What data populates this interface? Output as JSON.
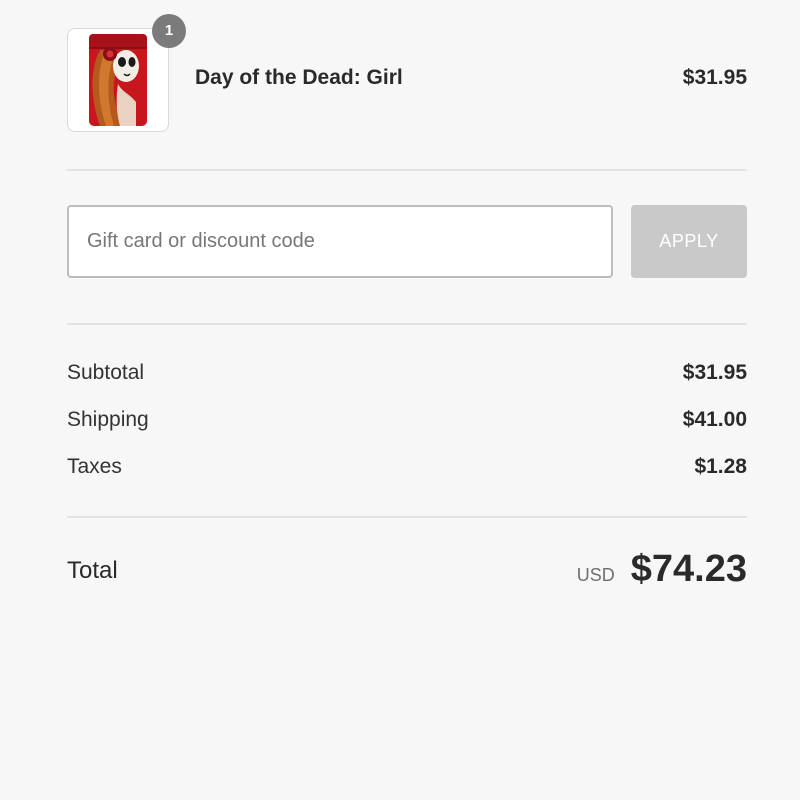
{
  "product": {
    "quantity": "1",
    "name": "Day of the Dead: Girl",
    "price": "$31.95",
    "thumbnail_icon": "day-of-the-dead-lighter-thumbnail"
  },
  "discount": {
    "placeholder": "Gift card or discount code",
    "value": "",
    "apply_label": "APPLY"
  },
  "summary": {
    "subtotal_label": "Subtotal",
    "subtotal_value": "$31.95",
    "shipping_label": "Shipping",
    "shipping_value": "$41.00",
    "taxes_label": "Taxes",
    "taxes_value": "$1.28"
  },
  "total": {
    "label": "Total",
    "currency": "USD",
    "amount": "$74.23"
  },
  "colors": {
    "background": "#f7f7f7",
    "apply_button_disabled": "#c9c9c9",
    "badge": "#7b7b7b",
    "product_red": "#c8161e"
  }
}
